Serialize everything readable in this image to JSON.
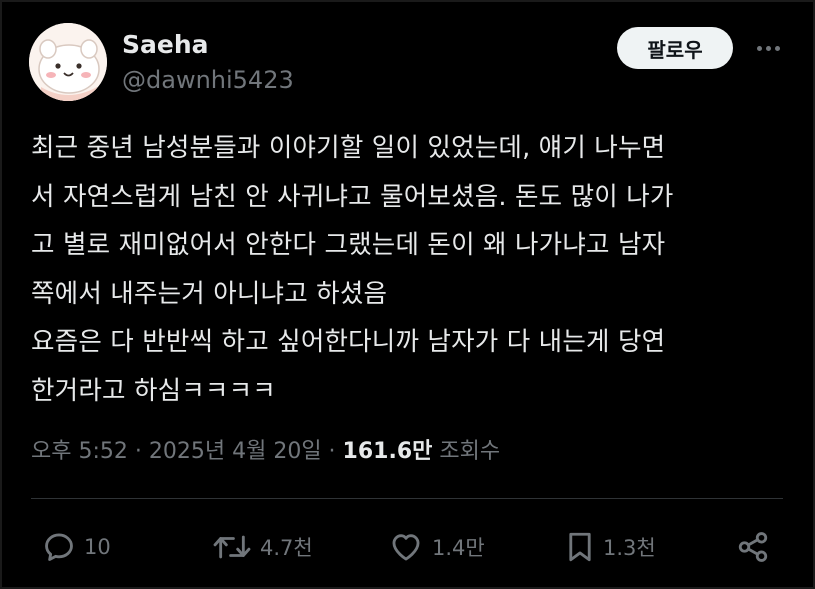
{
  "author": {
    "display_name": "Saeha",
    "handle": "@dawnhi5423"
  },
  "header": {
    "follow_label": "팔로우",
    "more_icon": "more-horizontal-icon"
  },
  "tweet": {
    "lines": [
      "최근 중년 남성분들과 이야기할 일이 있었는데, 얘기 나누면",
      "서 자연스럽게 남친 안 사귀냐고 물어보셨음. 돈도 많이 나가",
      "고 별로 재미없어서 안한다 그랬는데 돈이 왜 나가냐고 남자",
      "쪽에서 내주는거 아니냐고 하셨음",
      "요즘은 다 반반씩 하고 싶어한다니까 남자가 다 내는게 당연",
      "한거라고 하심ㅋㅋㅋㅋ"
    ]
  },
  "meta": {
    "time": "오후 5:52",
    "separator": " · ",
    "date": "2025년 4월 20일",
    "views_count": "161.6만",
    "views_label": "조회수"
  },
  "actions": {
    "reply": {
      "icon": "reply-icon",
      "count": "10"
    },
    "repost": {
      "icon": "repost-icon",
      "count": "4.7천"
    },
    "like": {
      "icon": "heart-icon",
      "count": "1.4만"
    },
    "bookmark": {
      "icon": "bookmark-icon",
      "count": "1.3천"
    },
    "share": {
      "icon": "share-icon"
    }
  },
  "colors": {
    "background": "#000000",
    "text_primary": "#e7e9ea",
    "text_secondary": "#71767b",
    "follow_button_bg": "#eff3f4",
    "divider": "#2f3336"
  }
}
